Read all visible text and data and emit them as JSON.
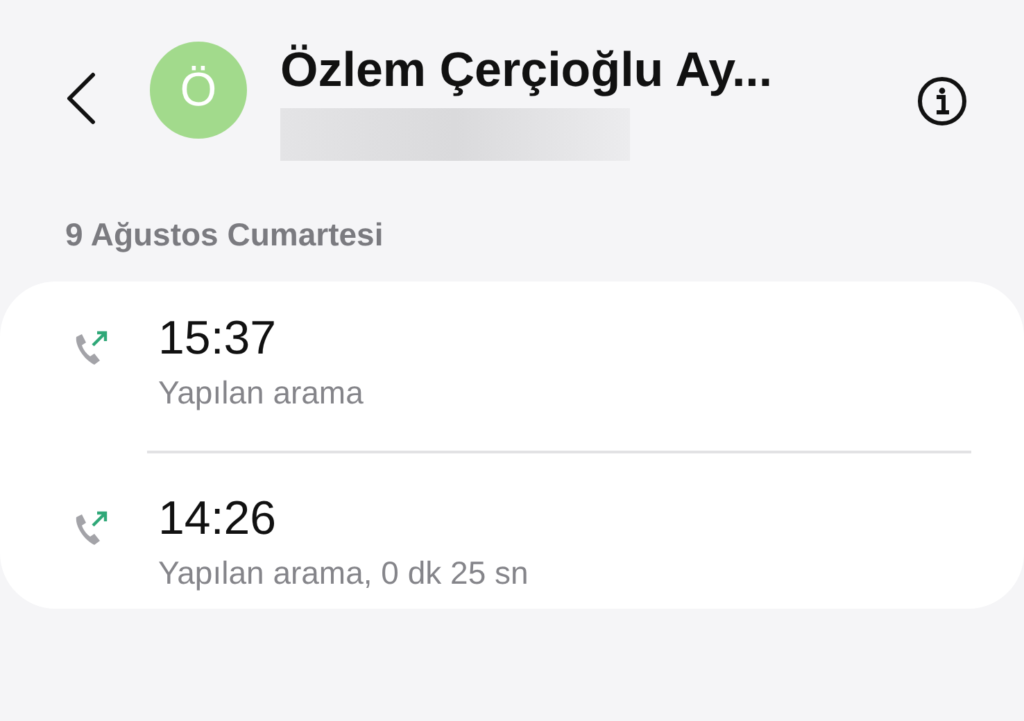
{
  "header": {
    "avatar_letter": "Ö",
    "name": "Özlem Çerçioğlu Ay...",
    "number_hidden": true
  },
  "date_label": "9 Ağustos Cumartesi",
  "calls": [
    {
      "kind": "outgoing",
      "time": "15:37",
      "detail": "Yapılan arama"
    },
    {
      "kind": "outgoing",
      "time": "14:26",
      "detail": "Yapılan arama, 0 dk 25 sn"
    }
  ]
}
